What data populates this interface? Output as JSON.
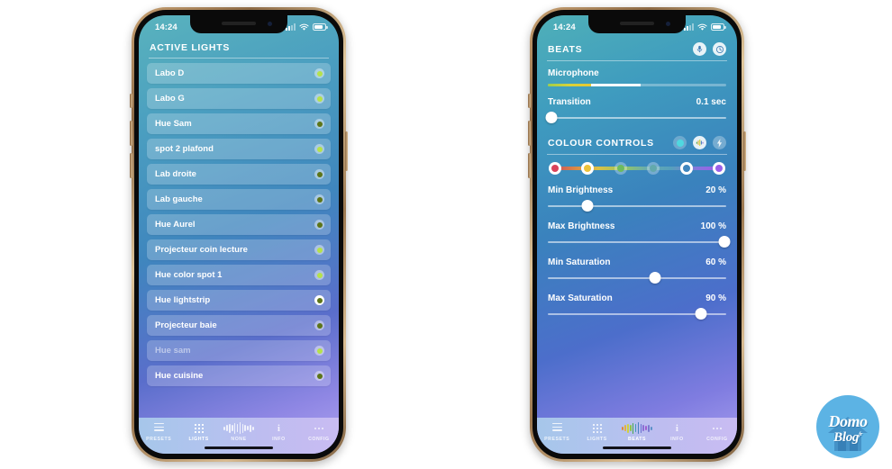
{
  "status_bar": {
    "time": "14:24",
    "signal_icon": "signal-bars-icon",
    "wifi_icon": "wifi-icon",
    "battery_icon": "battery-icon"
  },
  "left_phone": {
    "header": {
      "title": "ACTIVE LIGHTS"
    },
    "lights": [
      {
        "name": "Labo D",
        "state": "on",
        "dot": "bright",
        "dim": false
      },
      {
        "name": "Labo G",
        "state": "on",
        "dot": "bright",
        "dim": false
      },
      {
        "name": "Hue Sam",
        "state": "on",
        "dot": "dark",
        "dim": false
      },
      {
        "name": "spot 2 plafond",
        "state": "on",
        "dot": "bright",
        "dim": false
      },
      {
        "name": "Lab droite",
        "state": "on",
        "dot": "dark",
        "dim": false
      },
      {
        "name": "Lab gauche",
        "state": "on",
        "dot": "dark",
        "dim": false
      },
      {
        "name": "Hue Aurel",
        "state": "on",
        "dot": "dark",
        "dim": false
      },
      {
        "name": "Projecteur coin lecture",
        "state": "on",
        "dot": "bright",
        "dim": false
      },
      {
        "name": "Hue color spot 1",
        "state": "on",
        "dot": "bright",
        "dim": false
      },
      {
        "name": "Hue lightstrip",
        "state": "selected",
        "dot": "dark",
        "dim": false
      },
      {
        "name": "Projecteur baie",
        "state": "on",
        "dot": "dark",
        "dim": false
      },
      {
        "name": "Hue sam",
        "state": "on",
        "dot": "bright",
        "dim": true
      },
      {
        "name": "Hue cuisine",
        "state": "on",
        "dot": "dark",
        "dim": false
      }
    ],
    "tabs": [
      {
        "label": "PRESETS",
        "icon": "hamburger-icon",
        "active": false
      },
      {
        "label": "LIGHTS",
        "icon": "grid-icon",
        "active": true
      },
      {
        "label": "NONE",
        "icon": "waveform-icon",
        "active": false
      },
      {
        "label": "INFO",
        "icon": "info-icon",
        "active": false
      },
      {
        "label": "CONFIG",
        "icon": "ellipsis-icon",
        "active": false
      }
    ]
  },
  "right_phone": {
    "header": {
      "title": "BEATS",
      "icons": [
        {
          "name": "microphone-icon"
        },
        {
          "name": "clock-icon"
        }
      ]
    },
    "microphone": {
      "label": "Microphone",
      "level_primary_pct": 24,
      "level_peak_pct": 52
    },
    "transition": {
      "label": "Transition",
      "value": "0.1 sec",
      "knob_pct": 2
    },
    "colour_controls": {
      "title": "COLOUR CONTROLS",
      "icons": [
        {
          "name": "colour-dot-icon",
          "style": "cyan",
          "active": false
        },
        {
          "name": "waveform-icon",
          "style": "solid",
          "active": true
        },
        {
          "name": "lightning-icon",
          "style": "flat",
          "active": false
        }
      ],
      "swatches": [
        {
          "color": "#d9435b",
          "selected": true,
          "pos_pct": 0
        },
        {
          "color": "#edc23a",
          "selected": true,
          "pos_pct": 20
        },
        {
          "color": "#6cbb5e",
          "selected": false,
          "pos_pct": 40
        },
        {
          "color": "#63a9ac",
          "selected": false,
          "pos_pct": 60
        },
        {
          "color": "#ffffff",
          "selected": true,
          "pos_pct": 80
        },
        {
          "color": "#9a5fe8",
          "selected": true,
          "pos_pct": 100
        }
      ]
    },
    "sliders": [
      {
        "label": "Min Brightness",
        "value": "20 %",
        "knob_pct": 22
      },
      {
        "label": "Max Brightness",
        "value": "100 %",
        "knob_pct": 99
      },
      {
        "label": "Min Saturation",
        "value": "60 %",
        "knob_pct": 60
      },
      {
        "label": "Max Saturation",
        "value": "90 %",
        "knob_pct": 86
      }
    ],
    "tabs": [
      {
        "label": "PRESETS",
        "icon": "hamburger-icon",
        "active": false
      },
      {
        "label": "LIGHTS",
        "icon": "grid-icon",
        "active": false
      },
      {
        "label": "BEATS",
        "icon": "waveform-icon",
        "active": true
      },
      {
        "label": "INFO",
        "icon": "info-icon",
        "active": false
      },
      {
        "label": "CONFIG",
        "icon": "ellipsis-icon",
        "active": false
      }
    ]
  },
  "watermark": {
    "line1": "Domo",
    "line2": "Blog",
    "sup": "fr",
    "brand_color": "#5cb3e4"
  }
}
